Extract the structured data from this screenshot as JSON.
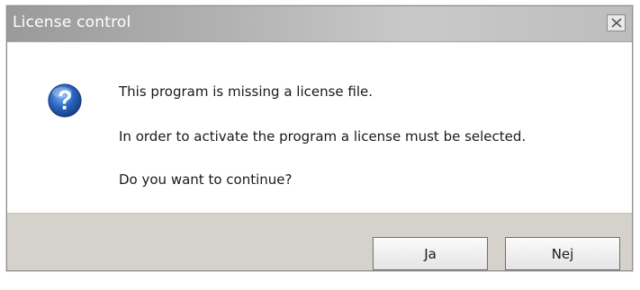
{
  "window": {
    "title": "License control",
    "close_icon": "close-icon"
  },
  "dialog": {
    "icon": "question-icon",
    "messages": [
      "This program is missing a license file.",
      "In order to activate the program a license must be selected.",
      "Do you want to continue?"
    ]
  },
  "buttons": {
    "yes_label": "Ja",
    "no_label": "Nej"
  },
  "colors": {
    "titlebar": "#b2b2b2",
    "button_bar": "#d5d1cb",
    "icon_blue": "#2a68c2"
  }
}
